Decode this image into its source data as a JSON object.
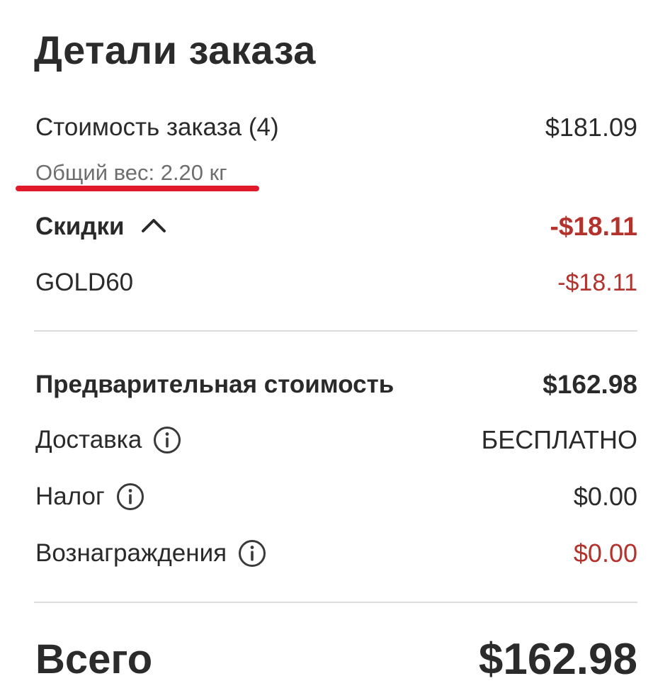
{
  "title": "Детали заказа",
  "subtotal": {
    "label": "Стоимость заказа (4)",
    "value": "$181.09"
  },
  "weight": {
    "label": "Общий вес: 2.20 кг"
  },
  "discounts": {
    "label": "Скидки",
    "value": "-$18.11",
    "expanded": true,
    "items": [
      {
        "code": "GOLD60",
        "value": "-$18.11"
      }
    ]
  },
  "pre_total": {
    "label": "Предварительная стоимость",
    "value": "$162.98"
  },
  "shipping": {
    "label": "Доставка",
    "value": "БЕСПЛАТНО",
    "icon": "info-icon"
  },
  "tax": {
    "label": "Налог",
    "value": "$0.00",
    "icon": "info-icon"
  },
  "rewards": {
    "label": "Вознаграждения",
    "value": "$0.00",
    "icon": "info-icon"
  },
  "total": {
    "label": "Всего",
    "value": "$162.98"
  },
  "colors": {
    "discount_red": "#b3322c",
    "annotation_red": "#e01a2b",
    "text": "#2a2a2a",
    "muted": "#6e6e6e",
    "divider": "#dcdcdc"
  }
}
